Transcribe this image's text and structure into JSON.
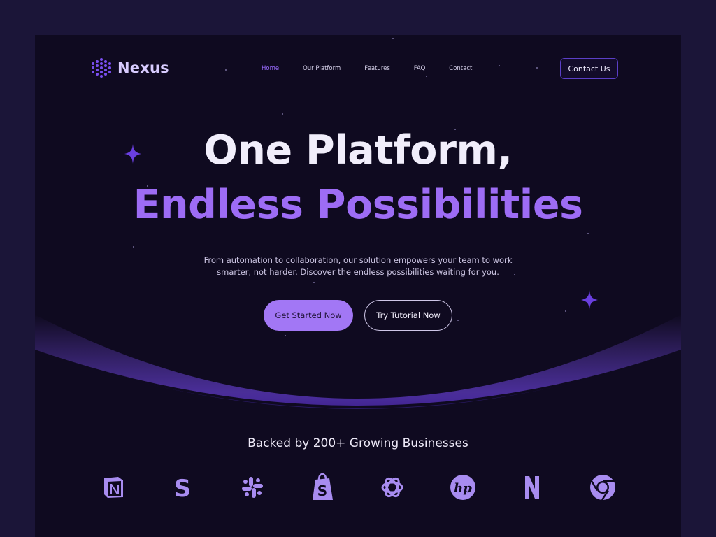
{
  "brand": {
    "name": "Nexus"
  },
  "nav": {
    "items": [
      {
        "label": "Home",
        "active": true
      },
      {
        "label": "Our Platform",
        "active": false
      },
      {
        "label": "Features",
        "active": false
      },
      {
        "label": "FAQ",
        "active": false
      },
      {
        "label": "Contact",
        "active": false
      }
    ],
    "cta": "Contact Us"
  },
  "hero": {
    "title_line1": "One Platform,",
    "title_line2": "Endless Possibilities",
    "subtitle": "From automation to collaboration, our solution empowers your team to work smarter, not harder. Discover the endless possibilities waiting for you.",
    "primary_button": "Get Started Now",
    "secondary_button": "Try Tutorial Now"
  },
  "partners": {
    "heading": "Backed by 200+ Growing Businesses",
    "logos": [
      "notion-logo",
      "skype-logo",
      "slack-logo",
      "shopify-logo",
      "openai-logo",
      "hp-logo",
      "netflix-logo",
      "chrome-logo"
    ]
  },
  "colors": {
    "background": "#0f0a20",
    "outer": "#1b1538",
    "accent": "#9d6cf5",
    "button": "#a277f5"
  }
}
